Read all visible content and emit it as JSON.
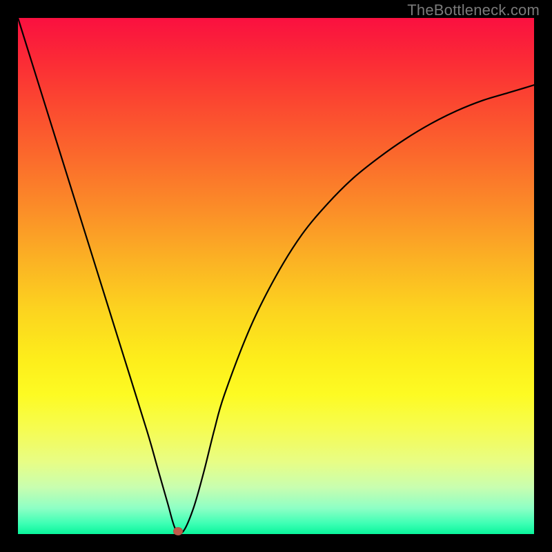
{
  "watermark": "TheBottleneck.com",
  "colors": {
    "page_bg": "#000000",
    "watermark": "#7a7a7a",
    "curve": "#000000",
    "marker": "#c05a4a"
  },
  "chart_data": {
    "type": "line",
    "title": "",
    "xlabel": "",
    "ylabel": "",
    "xlim": [
      0,
      100
    ],
    "ylim": [
      0,
      100
    ],
    "grid": false,
    "legend": false,
    "annotations": [],
    "series": [
      {
        "name": "bottleneck-curve",
        "x": [
          0,
          5,
          10,
          15,
          20,
          25,
          27,
          29,
          30.5,
          32,
          34,
          36,
          38,
          40,
          45,
          50,
          55,
          60,
          65,
          70,
          75,
          80,
          85,
          90,
          95,
          100
        ],
        "y": [
          100,
          84,
          68,
          52,
          36,
          20,
          13,
          6,
          1,
          0.5,
          5,
          12,
          20,
          27,
          40,
          50,
          58,
          64,
          69,
          73,
          76.5,
          79.5,
          82,
          84,
          85.5,
          87
        ]
      }
    ],
    "marker": {
      "x": 31,
      "y": 0.5
    }
  }
}
